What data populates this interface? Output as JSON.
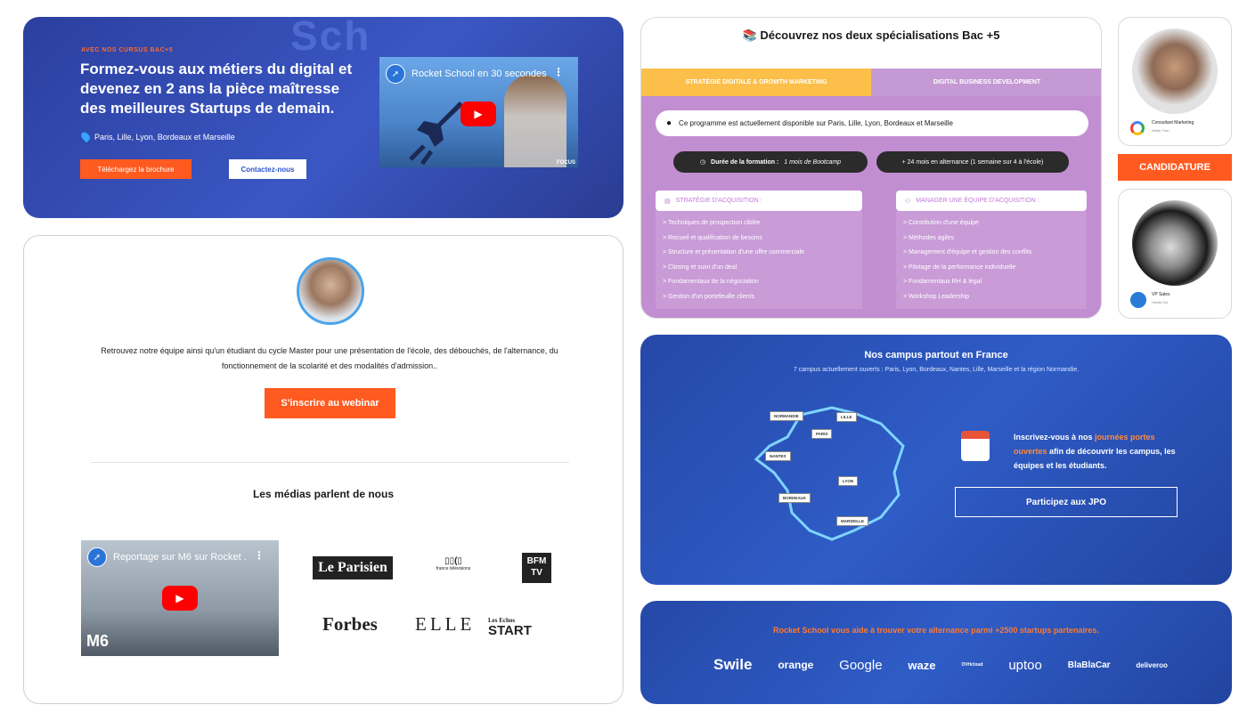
{
  "hero": {
    "watermark": "Sch",
    "eyebrow": "AVEC NOS CURSUS BAC+5",
    "title": "Formez-vous aux métiers du digital et devenez en 2 ans la pièce maîtresse des meilleures Startups de demain.",
    "location": "Paris, Lille, Lyon, Bordeaux et Marseille",
    "brochure_button": "Téléchargez la brochure",
    "contact_button": "Contactez-nous",
    "video": {
      "title": "Rocket School en 30 secondes",
      "brand": "FOCUS"
    }
  },
  "webinar": {
    "description": "Retrouvez notre équipe ainsi qu'un étudiant du cycle Master pour une présentation de l'école, des débouchés, de l'alternance, du fonctionnement de la scolarité et des modalités d'admission..",
    "cta": "S'inscrire au webinar",
    "medias_title": "Les médias parlent de nous",
    "video": {
      "title": "Reportage sur M6 sur Rocket ...",
      "brand": "M6"
    },
    "logos": {
      "parisien": "Le Parisien",
      "francetv_main": "▯▯(▯",
      "francetv_sub": "france télévisions",
      "bfm_top": "BFM",
      "bfm_bottom": "TV",
      "forbes": "Forbes",
      "elle": "ELLE",
      "echos_top": "Les Echos",
      "echos_bottom": "START"
    }
  },
  "specialisations": {
    "title": "Découvrez nos deux spécialisations Bac +5",
    "tabs": [
      "STRATÉGIE DIGITALE & GROWTH MARKETING",
      "DIGITAL BUSINESS DEVELOPMENT"
    ],
    "program_line": "Ce programme est actuellement disponible sur Paris, Lille, Lyon, Bordeaux et Marseille",
    "duration_label": "Durée de la formation :",
    "duration_value": "1 mois de Bootcamp",
    "alternance": "+ 24 mois en alternance (1 semaine sur 4 à l'école)",
    "left": {
      "head": "STRATÉGIE D'ACQUISITION :",
      "items": [
        "> Techniques de prospection ciblée",
        "> Recueil et qualification de besoins",
        "> Structure et présentation d'une offre commerciale",
        "> Closing et suivi d'un deal",
        "> Fondamentaux de la négociation",
        "> Gestion d'un portefeuille clients"
      ]
    },
    "right": {
      "head": "MANAGER UNE ÉQUIPE D'ACQUISITION :",
      "items": [
        "> Constitution d'une équipe",
        "> Méthodes agiles",
        "> Management d'équipe et gestion des conflits",
        "> Pilotage de la performance individuelle",
        "> Fondamentaux RH & légal",
        "> Workshop Leadership"
      ]
    }
  },
  "testimonials": [
    {
      "role": "Consultant Marketing",
      "name": "Nolah Tran"
    },
    {
      "role": "VP Sales",
      "name": "Heully Dol"
    }
  ],
  "candidature": "CANDIDATURE",
  "campus": {
    "title": "Nos campus partout en France",
    "subtitle": "7 campus actuellement ouverts : Paris, Lyon, Bordeaux, Nantes, Lille, Marseille et la région Normandie.",
    "cities": [
      "NORMANDIE",
      "LILLE",
      "PARIS",
      "NANTES",
      "LYON",
      "BORDEAUX",
      "MARSEILLE"
    ],
    "jpo_text_1": "Inscrivez-vous à nos ",
    "jpo_highlight": "journées portes ouvertes",
    "jpo_text_2": " afin de découvrir les campus, les équipes et les étudiants.",
    "jpo_button": "Participez aux JPO"
  },
  "partners": {
    "title": "Rocket School vous aide à trouver votre alternance parmi +2500 startups partenaires.",
    "logos": [
      "Swile",
      "orange",
      "Google",
      "waze",
      "OVHcloud",
      "uptoo",
      "BlaBlaCar",
      "deliveroo"
    ]
  },
  "colors": {
    "orange": "#ff5a1f",
    "blue": "#2f5cc6",
    "purple": "#c28ed2",
    "yellow": "#fbbf4a"
  }
}
